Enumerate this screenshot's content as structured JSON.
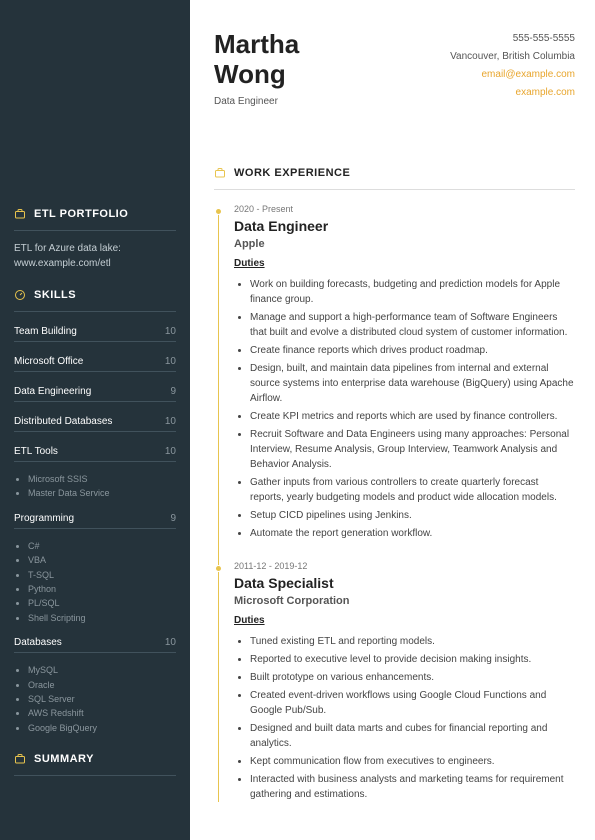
{
  "header": {
    "first_name": "Martha",
    "last_name": "Wong",
    "title": "Data Engineer",
    "phone": "555-555-5555",
    "location": "Vancouver, British Columbia",
    "email": "email@example.com",
    "website": "example.com"
  },
  "main_sections": {
    "work_experience_heading": "WORK EXPERIENCE"
  },
  "jobs": [
    {
      "period": "2020 - Present",
      "role": "Data Engineer",
      "company": "Apple",
      "duties_label": "Duties",
      "duties": [
        "Work on building forecasts, budgeting and prediction models for Apple finance group.",
        "Manage and support a high-performance team of Software Engineers that built and evolve a distributed cloud system of customer information.",
        "Create finance reports which drives product roadmap.",
        "Design, built, and maintain data pipelines from internal and external source systems into enterprise data warehouse (BigQuery) using Apache Airflow.",
        "Create KPI metrics and reports which are used by finance controllers.",
        "Recruit Software and Data Engineers using many approaches: Personal Interview, Resume Analysis, Group Interview, Teamwork Analysis and Behavior Analysis.",
        "Gather inputs from various controllers to create quarterly forecast reports, yearly budgeting models and product wide allocation models.",
        "Setup CICD pipelines using Jenkins.",
        "Automate the report generation workflow."
      ]
    },
    {
      "period": "2011-12 - 2019-12",
      "role": "Data Specialist",
      "company": "Microsoft Corporation",
      "duties_label": "Duties",
      "duties": [
        "Tuned existing ETL and reporting models.",
        "Reported to executive level to provide decision making insights.",
        "Built prototype on various enhancements.",
        "Created event-driven workflows using Google Cloud Functions and Google Pub/Sub.",
        "Designed and built data marts and cubes for financial reporting and analytics.",
        "Kept communication flow from executives to engineers.",
        "Interacted with business analysts and marketing teams for requirement gathering and estimations."
      ]
    }
  ],
  "sidebar": {
    "portfolio_heading": "ETL PORTFOLIO",
    "portfolio_line1": "ETL for Azure data lake:",
    "portfolio_line2": "www.example.com/etl",
    "skills_heading": "SKILLS",
    "summary_heading": "SUMMARY",
    "skills": [
      {
        "name": "Team Building",
        "score": "10",
        "items": []
      },
      {
        "name": "Microsoft Office",
        "score": "10",
        "items": []
      },
      {
        "name": "Data Engineering",
        "score": "9",
        "items": []
      },
      {
        "name": "Distributed Databases",
        "score": "10",
        "items": []
      },
      {
        "name": "ETL Tools",
        "score": "10",
        "items": [
          "Microsoft SSIS",
          "Master Data Service"
        ]
      },
      {
        "name": "Programming",
        "score": "9",
        "items": [
          "C#",
          "VBA",
          "T-SQL",
          "Python",
          "PL/SQL",
          "Shell Scripting"
        ]
      },
      {
        "name": "Databases",
        "score": "10",
        "items": [
          "MySQL",
          "Oracle",
          "SQL Server",
          "AWS Redshift",
          "Google BigQuery"
        ]
      }
    ]
  }
}
